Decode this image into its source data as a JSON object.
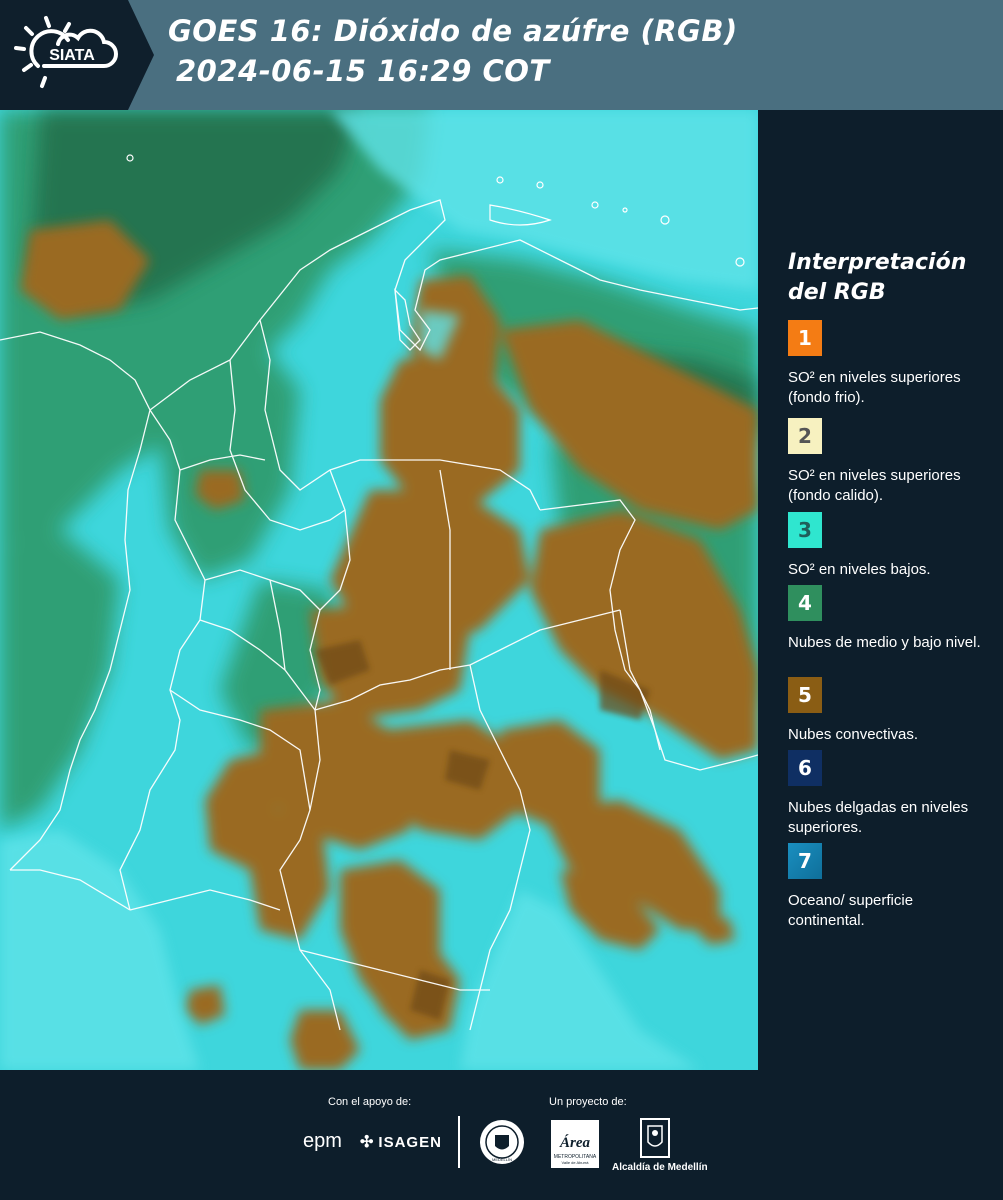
{
  "header": {
    "logo_text": "SIATA",
    "title_line1": "GOES 16: Dióxido de azúfre (RGB)",
    "title_line2": "2024-06-15 16:29 COT"
  },
  "legend": {
    "title": "Interpretación del RGB",
    "items": [
      {
        "number": "1",
        "color": "#f47c14",
        "label": "SO² en niveles superiores (fondo frio)."
      },
      {
        "number": "2",
        "color": "#f7f1c0",
        "label": "SO² en niveles superiores (fondo calido)."
      },
      {
        "number": "3",
        "color": "#2fe6cf",
        "label": "SO² en niveles bajos."
      },
      {
        "number": "4",
        "color": "#2f8f5e",
        "label": "Nubes de medio y bajo nivel."
      },
      {
        "number": "5",
        "color": "#8a5d14",
        "label": "Nubes convectivas."
      },
      {
        "number": "6",
        "color": "#0f2f63",
        "label": "Nubes delgadas en niveles superiores."
      },
      {
        "number": "7",
        "color": "#1a8fc0",
        "label": "Oceano/ superficie continental."
      }
    ]
  },
  "footer": {
    "support_label": "Con el apoyo de:",
    "project_label": "Un proyecto de:",
    "epm": "epm",
    "isagen": "ISAGEN",
    "area_name": "Área",
    "area_sub": "METROPOLITANA",
    "area_sub2": "Valle de Aburrá",
    "alcaldia": "Alcaldía de Medellín",
    "seal_text": "MEDELLÍN"
  },
  "map": {
    "colors": {
      "ocean": "#3ed6dc",
      "convective": "#9a6b22",
      "dark_convective": "#6e4a15",
      "mid_low": "#2f9a6a",
      "green_dark": "#226b46",
      "borders": "#ffffff"
    }
  }
}
